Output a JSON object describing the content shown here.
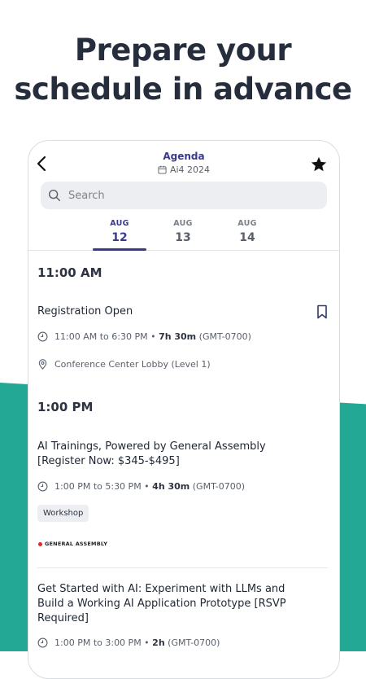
{
  "headline": {
    "line1": "Prepare your",
    "line2": "schedule in advance"
  },
  "header": {
    "title": "Agenda",
    "event": "Ai4 2024"
  },
  "search": {
    "placeholder": "Search"
  },
  "days": [
    {
      "month": "AUG",
      "day": "12"
    },
    {
      "month": "AUG",
      "day": "13"
    },
    {
      "month": "AUG",
      "day": "14"
    }
  ],
  "sections": [
    {
      "time": "11:00 AM",
      "session": {
        "title": "Registration Open",
        "time_range": "11:00 AM to 6:30 PM",
        "duration": "7h 30m",
        "tz": "(GMT-0700)",
        "location": "Conference Center Lobby (Level 1)"
      }
    },
    {
      "time": "1:00 PM",
      "sessions": [
        {
          "title_line1": "AI Trainings, Powered by General Assembly",
          "title_line2": "[Register Now: $345-$495]",
          "time_range": "1:00 PM to 5:30 PM",
          "duration": "4h 30m",
          "tz": "(GMT-0700)",
          "tag": "Workshop",
          "sponsor": "GENERAL ASSEMBLY"
        },
        {
          "title_line1": "Get Started with AI: Experiment with LLMs and",
          "title_line2": "Build a Working AI Application Prototype [RSVP",
          "title_line3": "Required]",
          "time_range": "1:00 PM to 3:00 PM",
          "duration": "2h",
          "tz": "(GMT-0700)"
        }
      ]
    }
  ],
  "colors": {
    "accent": "#3a3a8c",
    "teal": "#22a894",
    "headline": "#262d3c"
  }
}
